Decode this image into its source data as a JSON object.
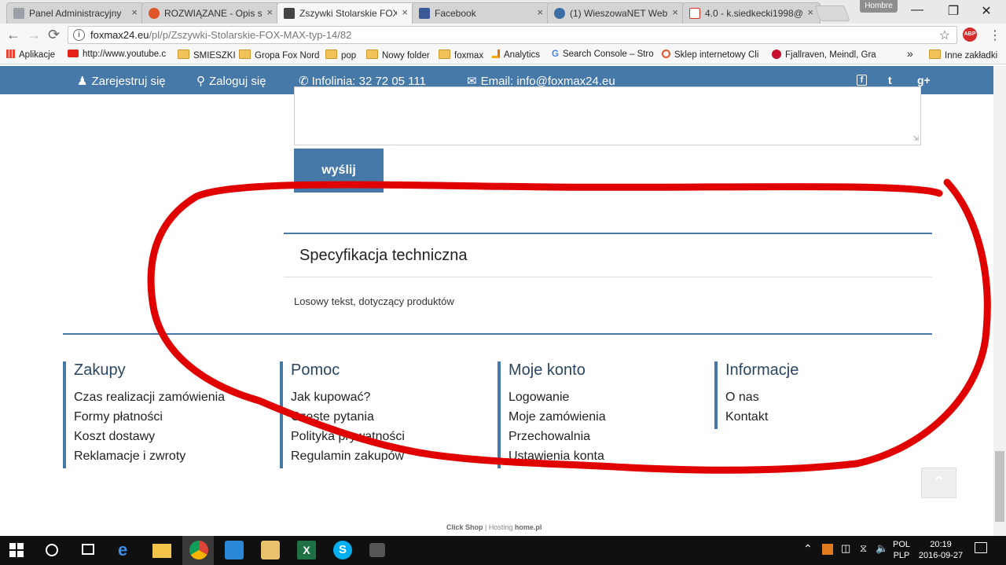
{
  "browser": {
    "tabs": [
      {
        "title": "Panel Administracyjny",
        "close": "×",
        "icon": "page-icon",
        "color": "#9aa0a6"
      },
      {
        "title": "ROZWIĄZANE - Opis s",
        "close": "×",
        "icon": "lifebuoy-icon",
        "color": "#e0562a"
      },
      {
        "title": "Zszywki Stolarskie FOX",
        "close": "×",
        "icon": "staple-icon",
        "color": "#444444"
      },
      {
        "title": "Facebook",
        "close": "×",
        "icon": "facebook-icon",
        "color": "#3b5998"
      },
      {
        "title": "(1) WieszowaNET Web",
        "close": "×",
        "icon": "globe-icon",
        "color": "#3a6ea5"
      },
      {
        "title": "4.0 - k.siedkecki1998@",
        "close": "×",
        "icon": "gmail-icon",
        "color": "#d93025"
      }
    ],
    "profile_name": "Hombre",
    "window_controls": {
      "minimize": "—",
      "maximize": "❐",
      "close": "✕"
    },
    "nav": {
      "back": "←",
      "forward": "→",
      "reload": "⟳"
    },
    "url_host": "foxmax24.eu",
    "url_path": "/pl/p/Zszywki-Stolarskie-FOX-MAX-typ-14/82",
    "info_glyph": "i",
    "star_glyph": "☆",
    "abp_label": "ABP",
    "menu_glyph": "⋮",
    "bookmarks": [
      {
        "label": "Aplikacje",
        "icon": "apps-grid-icon"
      },
      {
        "label": "http://www.youtube.c",
        "icon": "youtube-icon"
      },
      {
        "label": "SMIESZKI",
        "icon": "folder-icon"
      },
      {
        "label": "Gropa Fox Nord",
        "icon": "folder-icon"
      },
      {
        "label": "pop",
        "icon": "folder-icon"
      },
      {
        "label": "Nowy folder",
        "icon": "folder-icon"
      },
      {
        "label": "foxmax",
        "icon": "folder-icon"
      },
      {
        "label": "Analytics",
        "icon": "analytics-icon"
      },
      {
        "label": "Search Console – Stro",
        "icon": "google-icon"
      },
      {
        "label": "Sklep internetowy Cli",
        "icon": "lifebuoy-icon"
      },
      {
        "label": "Fjallraven, Meindl, Gra",
        "icon": "brand-icon"
      }
    ],
    "bookmarks_overflow": "»",
    "other_bookmarks": "Inne zakładki"
  },
  "site": {
    "topbar": {
      "register": "Zarejestruj się",
      "login": "Zaloguj się",
      "phone": "Infolinia: 32 72 05 111",
      "email": "Email: info@foxmax24.eu",
      "social": {
        "facebook": "f",
        "twitter": "t",
        "gplus": "g+"
      }
    },
    "send_button": "wyślij",
    "spec": {
      "title": "Specyfikacja techniczna",
      "text": "Losowy tekst, dotyczący produktów"
    },
    "footer": {
      "columns": [
        {
          "title": "Zakupy",
          "items": [
            "Czas realizacji zamówienia",
            "Formy płatności",
            "Koszt dostawy",
            "Reklamacje i zwroty"
          ]
        },
        {
          "title": "Pomoc",
          "items": [
            "Jak kupować?",
            "Częste pytania",
            "Polityka prywatności",
            "Regulamin zakupów"
          ]
        },
        {
          "title": "Moje konto",
          "items": [
            "Logowanie",
            "Moje zamówienia",
            "Przechowalnia",
            "Ustawienia konta"
          ]
        },
        {
          "title": "Informacje",
          "items": [
            "O nas",
            "Kontakt"
          ]
        }
      ],
      "credit_brand": "Click Shop",
      "credit_sep": " | Hosting ",
      "credit_host": "home.pl"
    },
    "to_top_glyph": "⌃",
    "annotation_color": "#e00000"
  },
  "taskbar": {
    "lang_top": "POL",
    "lang_bottom": "PLP",
    "time": "20:19",
    "date": "2016-09-27"
  }
}
